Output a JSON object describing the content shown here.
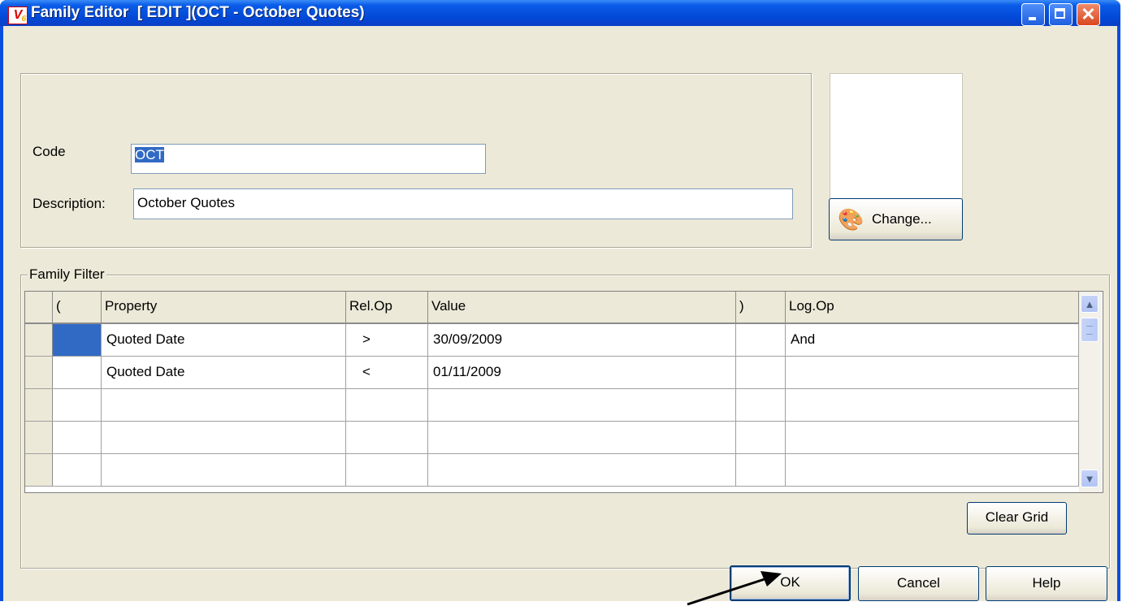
{
  "window": {
    "title": "Family Editor  [ EDIT ](OCT - October Quotes)"
  },
  "form": {
    "code_label": "Code",
    "code_value": "OCT",
    "description_label": "Description:",
    "description_value": "October Quotes"
  },
  "image_panel": {
    "change_button": "Change..."
  },
  "filter": {
    "group_label": "Family Filter",
    "columns": [
      "(",
      "Property",
      "Rel.Op",
      "Value",
      ")",
      "Log.Op"
    ],
    "rows": [
      {
        "open": "",
        "property": "Quoted Date",
        "relop": ">",
        "value": "30/09/2009",
        "close": "",
        "logop": "And"
      },
      {
        "open": "",
        "property": "Quoted Date",
        "relop": "<",
        "value": "01/11/2009",
        "close": "",
        "logop": ""
      },
      {
        "open": "",
        "property": "",
        "relop": "",
        "value": "",
        "close": "",
        "logop": ""
      },
      {
        "open": "",
        "property": "",
        "relop": "",
        "value": "",
        "close": "",
        "logop": ""
      },
      {
        "open": "",
        "property": "",
        "relop": "",
        "value": "",
        "close": "",
        "logop": ""
      }
    ],
    "clear_button": "Clear Grid"
  },
  "footer": {
    "ok": "OK",
    "cancel": "Cancel",
    "help": "Help"
  }
}
